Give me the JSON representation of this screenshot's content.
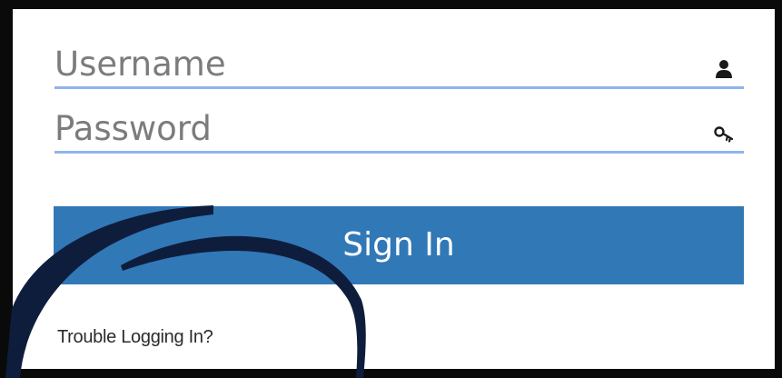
{
  "login_form": {
    "username": {
      "placeholder": "Username",
      "value": "",
      "icon": "user-icon"
    },
    "password": {
      "placeholder": "Password",
      "value": "",
      "icon": "key-icon"
    },
    "sign_in_label": "Sign In",
    "trouble_link": "Trouble Logging In?"
  },
  "colors": {
    "button": "#3178b6",
    "field_underline": "#8fb4ea",
    "frame": "#0a0a0a",
    "swoosh": "#0f1d3d"
  }
}
